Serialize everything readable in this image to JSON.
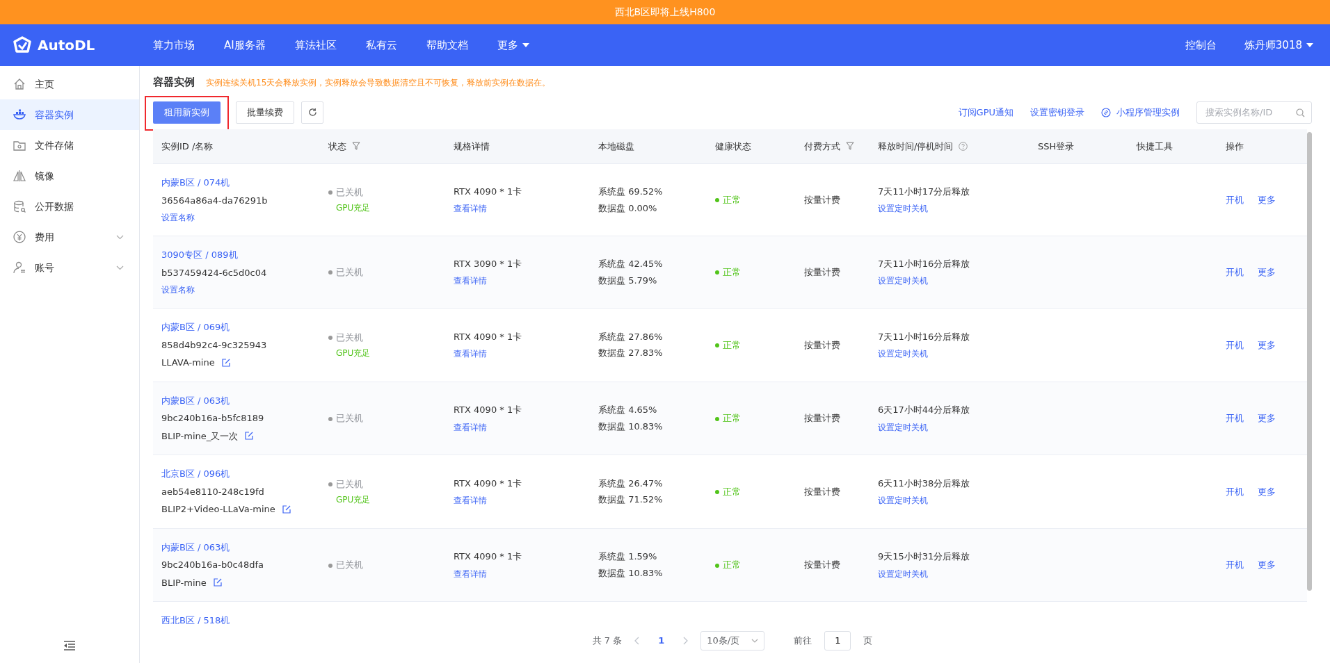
{
  "banner": {
    "text": "西北B区即将上线H800"
  },
  "navbar": {
    "brand": "AutoDL",
    "items": [
      {
        "label": "算力市场",
        "kind": "link"
      },
      {
        "label": "AI服务器",
        "kind": "link"
      },
      {
        "label": "算法社区",
        "kind": "link"
      },
      {
        "label": "私有云",
        "kind": "link"
      },
      {
        "label": "帮助文档",
        "kind": "link"
      },
      {
        "label": "更多",
        "kind": "dropdown"
      }
    ],
    "console": "控制台",
    "user": "炼丹师3018"
  },
  "sidebar": {
    "items": [
      {
        "label": "主页",
        "kind": "home",
        "selected": false,
        "expandable": false
      },
      {
        "label": "容器实例",
        "kind": "container",
        "selected": true,
        "expandable": false
      },
      {
        "label": "文件存储",
        "kind": "storage",
        "selected": false,
        "expandable": false
      },
      {
        "label": "镜像",
        "kind": "mirror",
        "selected": false,
        "expandable": false
      },
      {
        "label": "公开数据",
        "kind": "data",
        "selected": false,
        "expandable": false
      },
      {
        "label": "费用",
        "kind": "yen",
        "selected": false,
        "expandable": true
      },
      {
        "label": "账号",
        "kind": "user",
        "selected": false,
        "expandable": true
      }
    ]
  },
  "page": {
    "title": "容器实例",
    "notice": "实例连续关机15天会释放实例，实例释放会导致数据清空且不可恢复，释放前实例在数据在。"
  },
  "buttons": [
    {
      "label": "租用新实例",
      "kind": "primary",
      "highlighted": true
    },
    {
      "label": "批量续费",
      "kind": "default",
      "highlighted": false
    },
    {
      "kind": "refresh",
      "highlighted": false
    }
  ],
  "links": [
    {
      "label": "订阅GPU通知",
      "kind": "plain"
    },
    {
      "label": "设置密钥登录",
      "kind": "plain"
    },
    {
      "label": "小程序管理实例",
      "kind": "icon"
    }
  ],
  "search": {
    "placeholder": "搜索实例名称/ID"
  },
  "table": {
    "columns": [
      {
        "label": "实例ID /名称",
        "kind": "plain"
      },
      {
        "label": "状态",
        "kind": "filter"
      },
      {
        "label": "规格详情",
        "kind": "plain"
      },
      {
        "label": "本地磁盘",
        "kind": "plain"
      },
      {
        "label": "健康状态",
        "kind": "plain"
      },
      {
        "label": "付费方式",
        "kind": "filter"
      },
      {
        "label": "释放时间/停机时间",
        "kind": "help"
      },
      {
        "label": "SSH登录",
        "kind": "plain"
      },
      {
        "label": "快捷工具",
        "kind": "plain"
      },
      {
        "label": "操作",
        "kind": "plain"
      }
    ],
    "rows": [
      {
        "zone": "内蒙B区 / 074机",
        "id": "36564a86a4-da76291b",
        "name_link": "设置名称",
        "status": "已关机",
        "gpu_note": "GPU充足",
        "spec": "RTX 4090 * 1卡",
        "detail_link": "查看详情",
        "system_disk": "系统盘 69.52%",
        "data_disk": "数据盘 0.00%",
        "health": "正常",
        "billing": "按量计费",
        "release": "7天11小时17分后释放",
        "timer_link": "设置定时关机",
        "actions": [
          "开机",
          "更多"
        ]
      },
      {
        "zone": "3090专区 / 089机",
        "id": "b537459424-6c5d0c04",
        "name_link": "设置名称",
        "status": "已关机",
        "spec": "RTX 3090 * 1卡",
        "detail_link": "查看详情",
        "system_disk": "系统盘 42.45%",
        "data_disk": "数据盘 5.79%",
        "health": "正常",
        "billing": "按量计费",
        "release": "7天11小时16分后释放",
        "timer_link": "设置定时关机",
        "actions": [
          "开机",
          "更多"
        ]
      },
      {
        "zone": "内蒙B区 / 069机",
        "id": "858d4b92c4-9c325943",
        "name": "LLAVA-mine",
        "status": "已关机",
        "gpu_note": "GPU充足",
        "spec": "RTX 4090 * 1卡",
        "detail_link": "查看详情",
        "system_disk": "系统盘 27.86%",
        "data_disk": "数据盘 27.83%",
        "health": "正常",
        "billing": "按量计费",
        "release": "7天11小时16分后释放",
        "timer_link": "设置定时关机",
        "actions": [
          "开机",
          "更多"
        ]
      },
      {
        "zone": "内蒙B区 / 063机",
        "id": "9bc240b16a-b5fc8189",
        "name": "BLIP-mine_又一次",
        "status": "已关机",
        "spec": "RTX 4090 * 1卡",
        "detail_link": "查看详情",
        "system_disk": "系统盘 4.65%",
        "data_disk": "数据盘 10.83%",
        "health": "正常",
        "billing": "按量计费",
        "release": "6天17小时44分后释放",
        "timer_link": "设置定时关机",
        "actions": [
          "开机",
          "更多"
        ]
      },
      {
        "zone": "北京B区 / 096机",
        "id": "aeb54e8110-248c19fd",
        "name": "BLIP2+Video-LLaVa-mine",
        "status": "已关机",
        "gpu_note": "GPU充足",
        "spec": "RTX 4090 * 1卡",
        "detail_link": "查看详情",
        "system_disk": "系统盘 26.47%",
        "data_disk": "数据盘 71.52%",
        "health": "正常",
        "billing": "按量计费",
        "release": "6天11小时38分后释放",
        "timer_link": "设置定时关机",
        "actions": [
          "开机",
          "更多"
        ]
      },
      {
        "zone": "内蒙B区 / 063机",
        "id": "9bc240b16a-b0c48dfa",
        "name": "BLIP-mine",
        "status": "已关机",
        "spec": "RTX 4090 * 1卡",
        "detail_link": "查看详情",
        "system_disk": "系统盘 1.59%",
        "data_disk": "数据盘 10.83%",
        "health": "正常",
        "billing": "按量计费",
        "release": "9天15小时31分后释放",
        "timer_link": "设置定时关机",
        "actions": [
          "开机",
          "更多"
        ]
      },
      {
        "zone": "西北B区 / 518机"
      }
    ]
  },
  "pagination": {
    "total": "共 7 条",
    "pages": [
      {
        "label": "1",
        "selected": true
      }
    ],
    "page_size": "10条/页",
    "goto": "前往",
    "goto_value": "1",
    "page_unit": "页"
  }
}
